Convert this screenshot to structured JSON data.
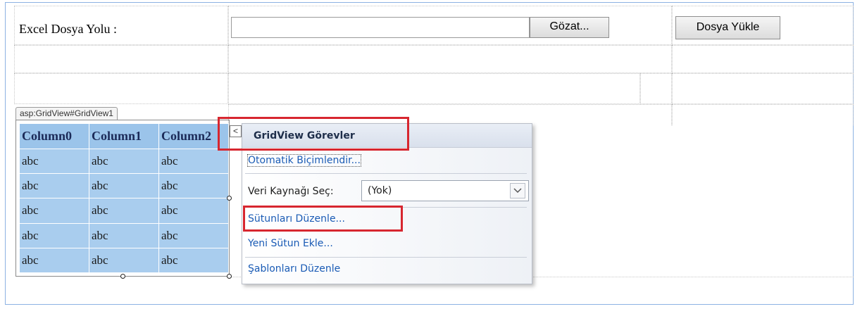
{
  "form": {
    "excel_label": "Excel Dosya Yolu :",
    "file_path_value": "",
    "browse_label": "Gözat...",
    "upload_label": "Dosya Yükle"
  },
  "gridview": {
    "tag": "asp:GridView#GridView1",
    "columns": [
      "Column0",
      "Column1",
      "Column2"
    ],
    "rows": [
      [
        "abc",
        "abc",
        "abc"
      ],
      [
        "abc",
        "abc",
        "abc"
      ],
      [
        "abc",
        "abc",
        "abc"
      ],
      [
        "abc",
        "abc",
        "abc"
      ],
      [
        "abc",
        "abc",
        "abc"
      ]
    ]
  },
  "smart_tag": {
    "collapse_glyph": "<",
    "title": "GridView Görevler",
    "auto_format": "Otomatik Biçimlendir...",
    "data_source_label": "Veri Kaynağı Seç:",
    "data_source_value": "(Yok)",
    "edit_columns": "Sütunları Düzenle...",
    "add_column": "Yeni Sütun Ekle...",
    "edit_templates": "Şablonları Düzenle"
  },
  "colors": {
    "highlight": "#d7262f",
    "grid_bg": "#a9cdee",
    "link": "#1a5bb5"
  }
}
